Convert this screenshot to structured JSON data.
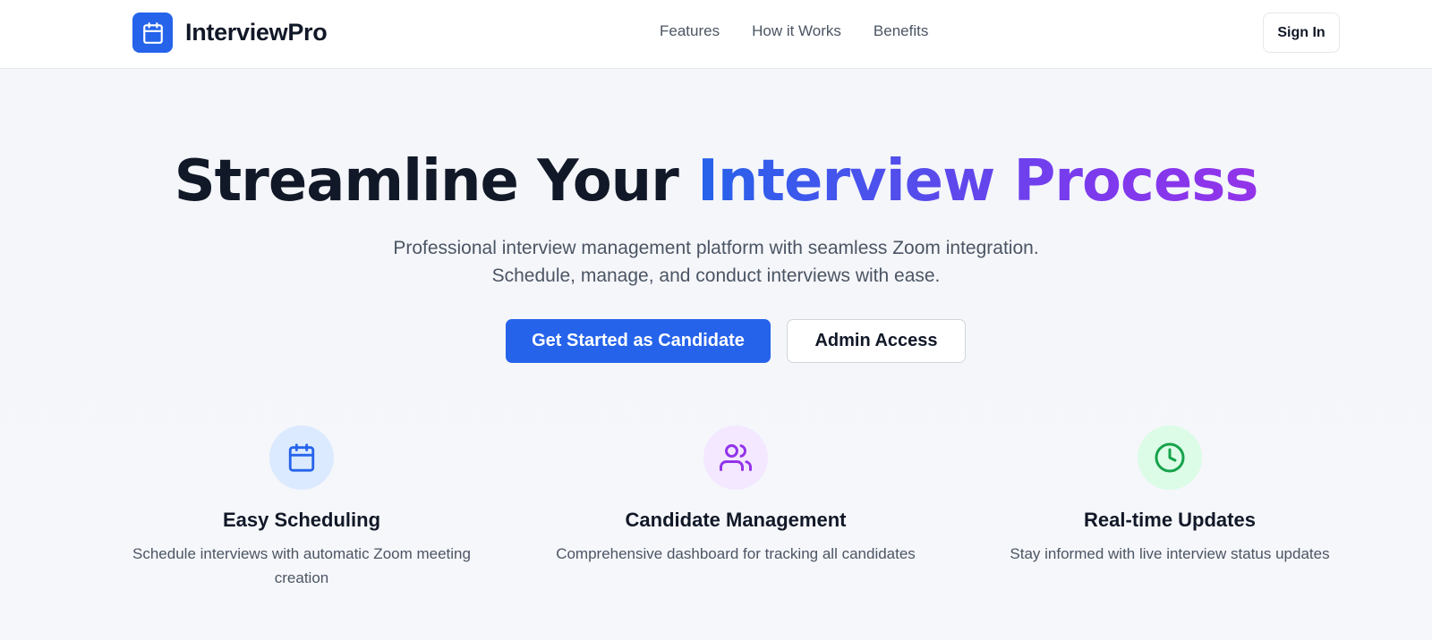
{
  "header": {
    "brand": "InterviewPro",
    "nav": [
      "Features",
      "How it Works",
      "Benefits"
    ],
    "sign_in": "Sign In"
  },
  "hero": {
    "title_plain": "Streamline Your",
    "title_highlight": "Interview Process",
    "subtitle_line1": "Professional interview management platform with seamless Zoom integration.",
    "subtitle_line2": "Schedule, manage, and conduct interviews with ease.",
    "primary_cta": "Get Started as Candidate",
    "secondary_cta": "Admin Access"
  },
  "features": [
    {
      "icon": "calendar-icon",
      "title": "Easy Scheduling",
      "description": "Schedule interviews with automatic Zoom meeting creation",
      "color": "#2563eb",
      "bg": "#dbeafe"
    },
    {
      "icon": "users-icon",
      "title": "Candidate Management",
      "description": "Comprehensive dashboard for tracking all candidates",
      "color": "#9333ea",
      "bg": "#f3e8ff"
    },
    {
      "icon": "clock-icon",
      "title": "Real-time Updates",
      "description": "Stay informed with live interview status updates",
      "color": "#16a34a",
      "bg": "#dcfce7"
    }
  ],
  "colors": {
    "brand": "#2563eb",
    "gradient_start": "#2563eb",
    "gradient_end": "#9333ea",
    "text_primary": "#111827",
    "text_secondary": "#4b5563"
  }
}
